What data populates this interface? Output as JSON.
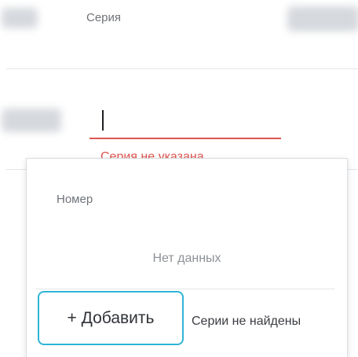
{
  "form": {
    "series_column_label": "Серия",
    "series_input_value": "",
    "series_error": "Серия не указана"
  },
  "dropdown": {
    "column_header": "Номер",
    "empty_text": "Нет данных",
    "add_button_label": "+ Добавить",
    "not_found_text": "Серии не найдены"
  },
  "colors": {
    "error": "#e0564f",
    "accent_border": "#2eb5d6"
  }
}
